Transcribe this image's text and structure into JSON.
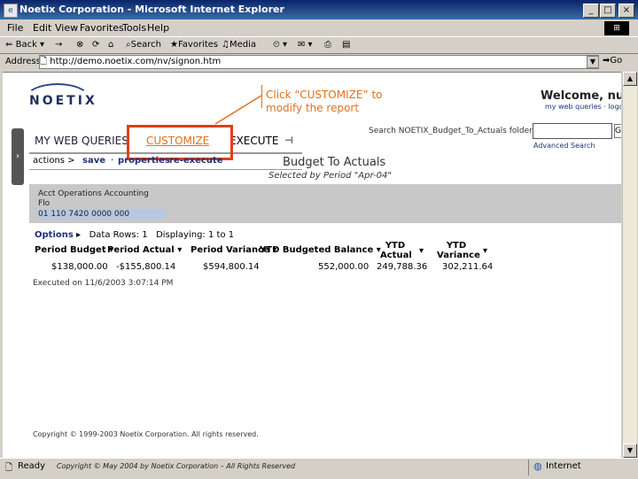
{
  "window": {
    "title": "Noetix Corporation - Microsoft Internet Explorer",
    "min": "_",
    "max": "□",
    "close": "×"
  },
  "menu": [
    "File",
    "Edit",
    "View",
    "Favorites",
    "Tools",
    "Help"
  ],
  "toolbar": {
    "back": "Back",
    "forward": "→",
    "search": "Search",
    "favorites": "Favorites",
    "media": "Media"
  },
  "address": {
    "label": "Address",
    "value": "http://demo.noetix.com/nv/signon.htm",
    "go": "Go"
  },
  "page": {
    "logo": "NOETIX",
    "callout": [
      "Click “CUSTOMIZE” to",
      "modify the report"
    ],
    "welcome": "Welcome, nuser",
    "user_links": "my web queries · logoff",
    "search_label": "Search  NOETIX_Budget_To_Actuals folder",
    "advanced_search": "Advanced Search",
    "tabs": {
      "my_web_queries": "MY WEB QUERIES",
      "customize": "CUSTOMIZE",
      "execute": "EXECUTE"
    },
    "actions": {
      "label": "actions >",
      "save": "save",
      "properties": "properties",
      "re_execute": "re-execute"
    },
    "report_title": "Budget To Actuals",
    "report_subtitle": "Selected by Period \"Apr-04\"",
    "param": {
      "label": [
        "Acct Operations Accounting",
        "Flo"
      ],
      "value": "01 110 7420 0000 000"
    },
    "options": {
      "label": "Options",
      "data_rows": "Data Rows: 1",
      "displaying": "Displaying: 1 to 1"
    },
    "table": {
      "headers": [
        "Period Budget",
        "Period Actual",
        "Period Variance",
        "YTD Budgeted Balance",
        "YTD Actual",
        "YTD Variance"
      ],
      "row": [
        "$138,000.00",
        "-$155,800.14",
        "$594,800.14",
        "552,000.00",
        "249,788.36",
        "302,211.64"
      ]
    },
    "executed": "Executed on 11/6/2003 3:07:14 PM",
    "copyright": "Copyright © 1999-2003 Noetix Corporation. All rights reserved."
  },
  "status": {
    "ready": "Ready",
    "copyright": "Copyright © May 2004 by Noetix Corporation – All Rights Reserved",
    "zone": "Internet"
  },
  "colors": {
    "titlebar": "#0a246a",
    "callout": "#e07020",
    "highlight_box": "#e04010",
    "link": "#203080"
  }
}
